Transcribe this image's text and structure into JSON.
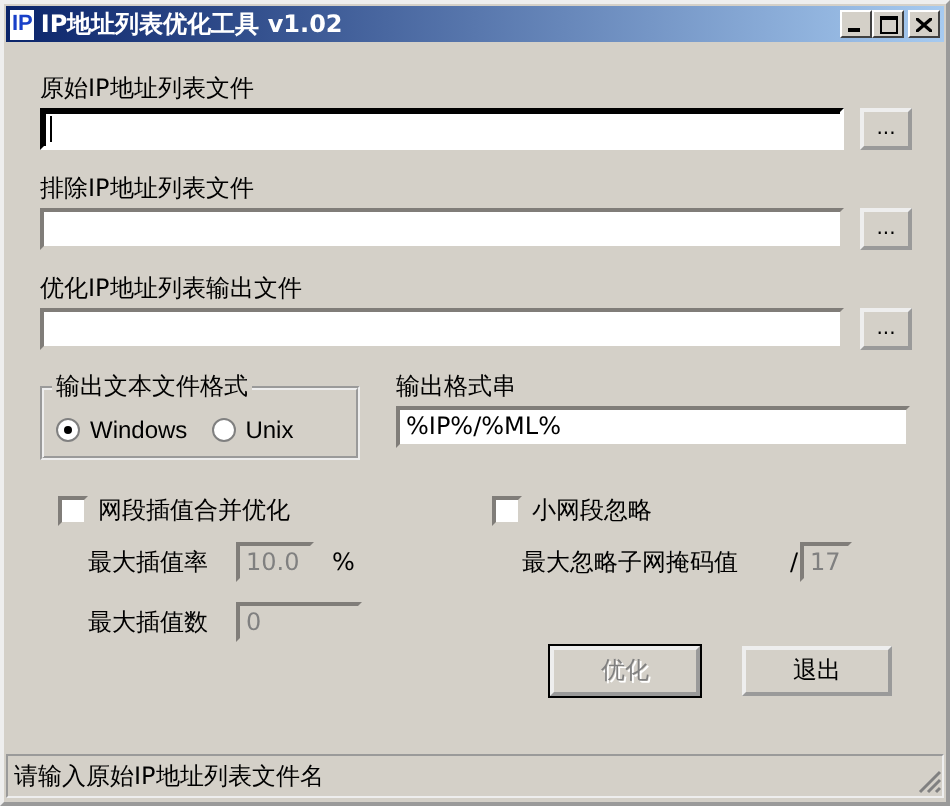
{
  "window": {
    "icon": "IP",
    "title": "IP地址列表优化工具 v1.02"
  },
  "file_fields": [
    {
      "label": "原始IP地址列表文件",
      "focused": true,
      "browse": "..."
    },
    {
      "label": "排除IP地址列表文件",
      "focused": false,
      "browse": "..."
    },
    {
      "label": "优化IP地址列表输出文件",
      "focused": false,
      "browse": "..."
    }
  ],
  "format_group": {
    "title": "输出文本文件格式",
    "options": [
      {
        "label": "Windows",
        "selected": true
      },
      {
        "label": "Unix",
        "selected": false
      }
    ]
  },
  "format_string": {
    "label": "输出格式串",
    "value": "%IP%/%ML%"
  },
  "merge": {
    "label": "网段插值合并优化",
    "checked": false,
    "rows": [
      {
        "label": "最大插值率",
        "value": "10.0",
        "unit": "%",
        "disabled": true
      },
      {
        "label": "最大插值数",
        "value": "0",
        "disabled": true
      }
    ]
  },
  "ignore": {
    "label": "小网段忽略",
    "checked": false,
    "row": {
      "label": "最大忽略子网掩码值",
      "prefix": "/",
      "value": "17",
      "disabled": true
    }
  },
  "buttons": [
    {
      "label": "优化",
      "disabled": true
    },
    {
      "label": "退出",
      "disabled": false
    }
  ],
  "status_bar": "请输入原始IP地址列表文件名"
}
